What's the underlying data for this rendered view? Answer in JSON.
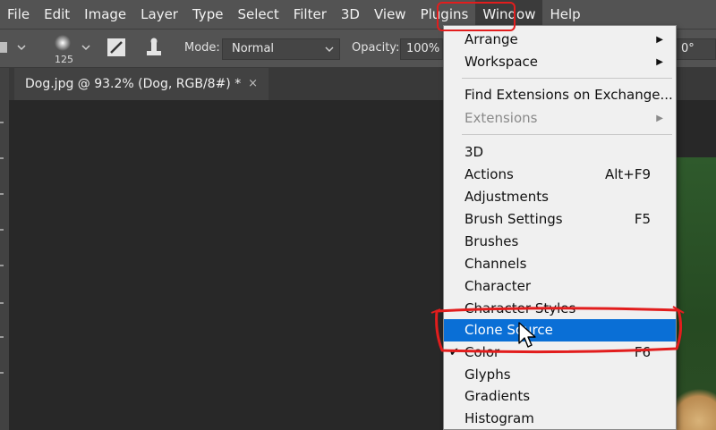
{
  "menubar": {
    "items": [
      "File",
      "Edit",
      "Image",
      "Layer",
      "Type",
      "Select",
      "Filter",
      "3D",
      "View",
      "Plugins",
      "Window",
      "Help"
    ],
    "active": "Window"
  },
  "options": {
    "brush_size": "125",
    "mode_label": "Mode:",
    "mode_value": "Normal",
    "opacity_label": "Opacity:",
    "opacity_value": "100%",
    "angle_value": "0°"
  },
  "document_tab": {
    "title": "Dog.jpg @ 93.2% (Dog, RGB/8#) *",
    "close": "×"
  },
  "window_menu": {
    "items": [
      {
        "label": "Arrange",
        "submenu": true
      },
      {
        "label": "Workspace",
        "submenu": true
      },
      {
        "label": "Find Extensions on Exchange..."
      },
      {
        "label": "Extensions",
        "submenu": true,
        "disabled": true
      },
      {
        "label": "3D"
      },
      {
        "label": "Actions",
        "shortcut": "Alt+F9"
      },
      {
        "label": "Adjustments"
      },
      {
        "label": "Brush Settings",
        "shortcut": "F5"
      },
      {
        "label": "Brushes"
      },
      {
        "label": "Channels"
      },
      {
        "label": "Character"
      },
      {
        "label": "Character Styles"
      },
      {
        "label": "Clone Source",
        "highlighted": true
      },
      {
        "label": "Color",
        "shortcut": "F6",
        "checked": true
      },
      {
        "label": "Glyphs"
      },
      {
        "label": "Gradients"
      },
      {
        "label": "Histogram"
      }
    ],
    "checkmark": "✔",
    "arrow": "▶"
  },
  "colors": {
    "menubar_bg": "#535353",
    "canvas_bg": "#282828",
    "menu_bg": "#f0f0f0",
    "highlight": "#0a6fd6",
    "annotation": "#e21d1d"
  }
}
